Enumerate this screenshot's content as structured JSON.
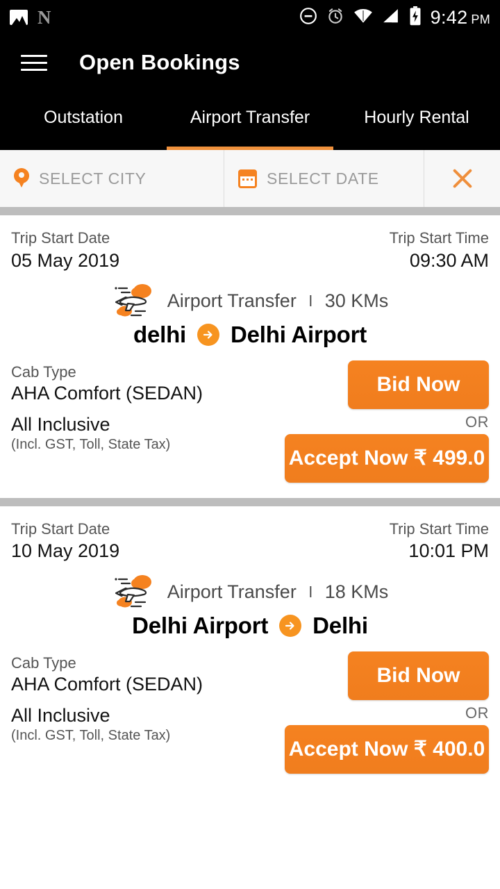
{
  "statusbar": {
    "icons_left": [
      "gallery-icon",
      "n-logo-icon"
    ],
    "icons_right": [
      "do-not-disturb-icon",
      "alarm-icon",
      "wifi-icon",
      "signal-icon",
      "battery-charging-icon"
    ],
    "time": "9:42",
    "ampm": "PM"
  },
  "appbar": {
    "menu_icon": "hamburger-menu-icon",
    "title": "Open Bookings"
  },
  "tabs": [
    {
      "label": "Outstation",
      "active": false
    },
    {
      "label": "Airport Transfer",
      "active": true
    },
    {
      "label": "Hourly Rental",
      "active": false
    }
  ],
  "filterbar": {
    "city": {
      "icon": "location-pin-icon",
      "label": "SELECT CITY"
    },
    "date": {
      "icon": "calendar-icon",
      "label": "SELECT DATE"
    },
    "close": {
      "icon": "close-icon"
    }
  },
  "colors": {
    "accent": "#f58220",
    "tab_indicator": "#f0913c",
    "divider": "#bdbdbd",
    "appbar_bg": "#000000",
    "filter_bg": "#f7f7f7"
  },
  "labels": {
    "trip_start_date": "Trip Start Date",
    "trip_start_time": "Trip Start Time",
    "cab_type": "Cab Type",
    "all_inclusive": "All Inclusive",
    "inclusive_note": "(Incl. GST, Toll, State Tax)",
    "bid_now": "Bid Now",
    "or": "OR",
    "route_arrow_icon": "arrow-right-circle-icon",
    "trip_type_icon": "airplane-icon",
    "separator": "l"
  },
  "bookings": [
    {
      "trip_start_date": "05 May 2019",
      "trip_start_time": "09:30 AM",
      "trip_type": "Airport Transfer",
      "distance": "30 KMs",
      "origin": "delhi",
      "destination": "Delhi Airport",
      "cab_type": "AHA Comfort  (SEDAN)",
      "accept_label": "Accept Now ₹ 499.0"
    },
    {
      "trip_start_date": "10 May 2019",
      "trip_start_time": "10:01 PM",
      "trip_type": "Airport Transfer",
      "distance": "18 KMs",
      "origin": "Delhi Airport",
      "destination": "Delhi",
      "cab_type": "AHA Comfort  (SEDAN)",
      "accept_label": "Accept Now ₹ 400.0"
    }
  ]
}
